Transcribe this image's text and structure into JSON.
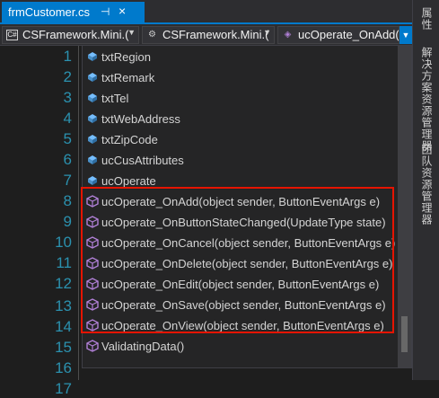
{
  "tab": {
    "title": "frmCustomer.cs",
    "pin": "⊣",
    "close": "×"
  },
  "nav": {
    "project": "CSFramework.Mini.(",
    "class": "CSFramework.Mini.(",
    "member": "ucOperate_OnAdd(o"
  },
  "line_numbers": [
    "1",
    "2",
    "3",
    "4",
    "5",
    "6",
    "7",
    "8",
    "9",
    "10",
    "11",
    "12",
    "13",
    "14",
    "15",
    "16",
    "17"
  ],
  "completion": {
    "items": [
      {
        "label": "txtRegion",
        "kind": "field"
      },
      {
        "label": "txtRemark",
        "kind": "field"
      },
      {
        "label": "txtTel",
        "kind": "field"
      },
      {
        "label": "txtWebAddress",
        "kind": "field"
      },
      {
        "label": "txtZipCode",
        "kind": "field"
      },
      {
        "label": "ucCusAttributes",
        "kind": "field"
      },
      {
        "label": "ucOperate",
        "kind": "field"
      },
      {
        "label": "ucOperate_OnAdd(object sender, ButtonEventArgs e)",
        "kind": "method"
      },
      {
        "label": "ucOperate_OnButtonStateChanged(UpdateType state)",
        "kind": "method"
      },
      {
        "label": "ucOperate_OnCancel(object sender, ButtonEventArgs e)",
        "kind": "method"
      },
      {
        "label": "ucOperate_OnDelete(object sender, ButtonEventArgs e)",
        "kind": "method"
      },
      {
        "label": "ucOperate_OnEdit(object sender, ButtonEventArgs e)",
        "kind": "method"
      },
      {
        "label": "ucOperate_OnSave(object sender, ButtonEventArgs e)",
        "kind": "method"
      },
      {
        "label": "ucOperate_OnView(object sender, ButtonEventArgs e)",
        "kind": "method"
      },
      {
        "label": "ValidatingData()",
        "kind": "method"
      }
    ]
  },
  "side_panel": {
    "tabs": [
      "属性",
      "解决方案资源管理器",
      "团队资源管理器"
    ]
  },
  "colors": {
    "accent": "#007acc",
    "highlight_border": "#e51400",
    "line_number": "#2b91af",
    "method_icon": "#b180d7",
    "field_icon": "#75beff"
  }
}
